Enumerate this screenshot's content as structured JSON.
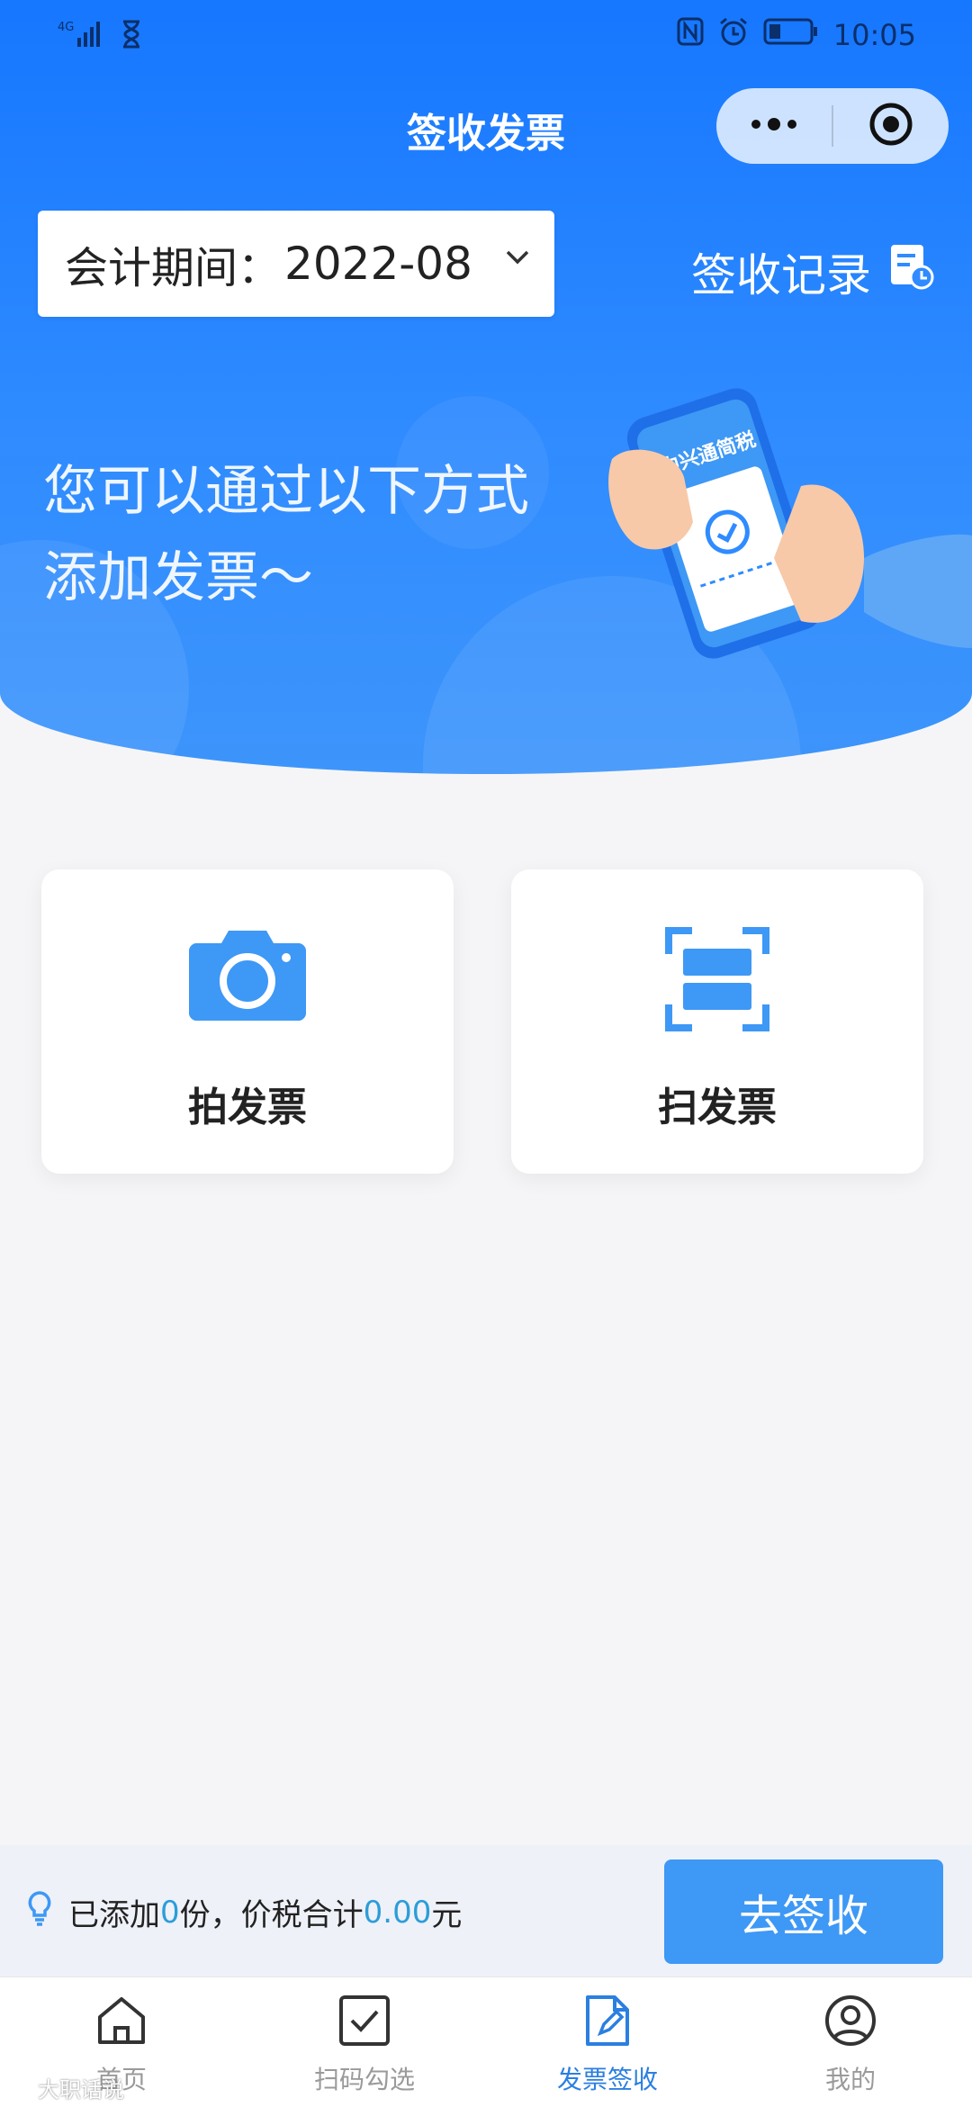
{
  "status_bar": {
    "network": "4G",
    "time": "10:05"
  },
  "nav": {
    "title": "签收发票"
  },
  "period": {
    "label": "会计期间：",
    "value": "2022-08"
  },
  "records": {
    "label": "签收记录"
  },
  "banner": {
    "line1": "您可以通过以下方式",
    "line2": "添加发票～",
    "phone_text": "中兴通简税"
  },
  "actions": [
    {
      "label": "拍发票",
      "icon": "camera-icon"
    },
    {
      "label": "扫发票",
      "icon": "scan-icon"
    }
  ],
  "summary": {
    "prefix": "已添加",
    "count": "0",
    "mid": "份，价税合计",
    "amount": "0.00",
    "suffix": "元",
    "button_label": "去签收"
  },
  "tabbar": {
    "tabs": [
      {
        "label": "首页",
        "icon": "home-icon"
      },
      {
        "label": "扫码勾选",
        "icon": "checkbox-icon"
      },
      {
        "label": "发票签收",
        "icon": "invoice-sign-icon"
      },
      {
        "label": "我的",
        "icon": "user-icon"
      }
    ],
    "active": "发票签收"
  },
  "watermark": "大职话说",
  "colors": {
    "primary": "#1677ff",
    "button": "#3e98f5",
    "active_tab": "#2b7fe0",
    "highlight": "#2c9dd9"
  }
}
